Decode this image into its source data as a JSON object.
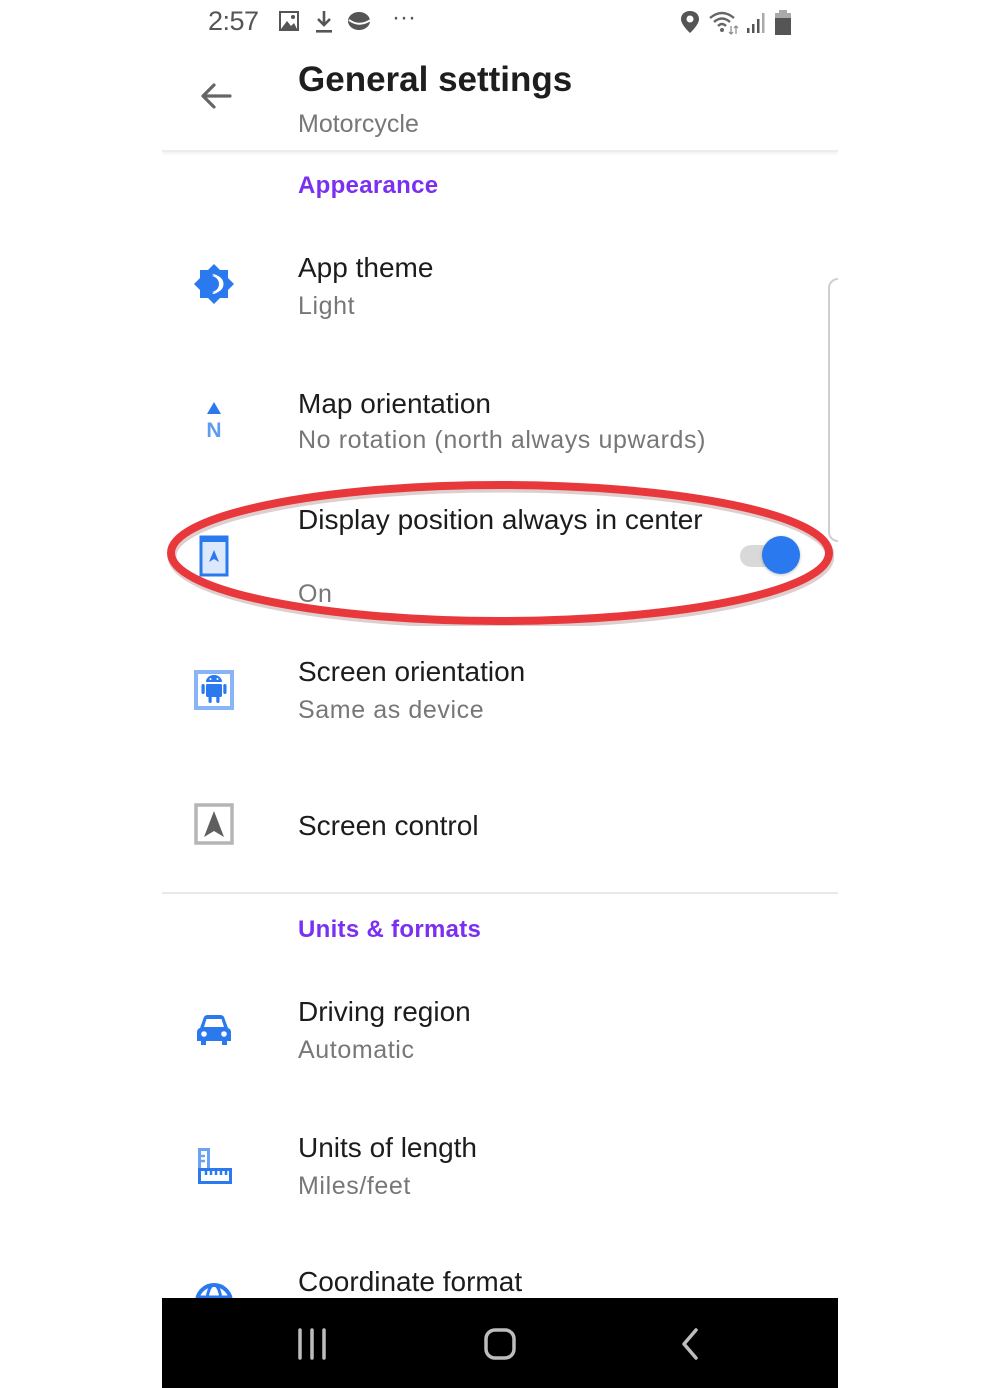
{
  "status_bar": {
    "time": "2:57",
    "left_icons": [
      "image-icon",
      "download-icon",
      "app-notification-icon",
      "more-dots-icon"
    ],
    "right_icons": [
      "location-icon",
      "wifi-icon",
      "signal-icon",
      "battery-icon"
    ],
    "more_label": "···"
  },
  "header": {
    "title": "General settings",
    "subtitle": "Motorcycle",
    "back_icon": "arrow-back-icon"
  },
  "sections": [
    {
      "title": "Appearance",
      "items": [
        {
          "label": "App theme",
          "value": "Light",
          "icon": "theme-brightness-icon"
        },
        {
          "label": "Map orientation",
          "value": "No rotation (north always upwards)",
          "icon": "north-arrow-icon"
        },
        {
          "label": "Display position always in center",
          "value": "On",
          "icon": "position-center-icon",
          "toggle": true,
          "toggle_on": true,
          "highlighted": true
        },
        {
          "label": "Screen orientation",
          "value": "Same as device",
          "icon": "android-screen-icon"
        },
        {
          "label": "Screen control",
          "value": "",
          "icon": "navigation-arrow-icon"
        }
      ]
    },
    {
      "title": "Units & formats",
      "items": [
        {
          "label": "Driving region",
          "value": "Automatic",
          "icon": "car-icon"
        },
        {
          "label": "Units of length",
          "value": "Miles/feet",
          "icon": "ruler-icon"
        },
        {
          "label": "Coordinate format",
          "value": "",
          "icon": "globe-icon"
        }
      ]
    }
  ],
  "nav_bar": {
    "recents": "recents-icon",
    "home": "home-icon",
    "back": "back-chevron-icon"
  },
  "colors": {
    "accent": "#2a79ee",
    "section_header": "#7b2ff0",
    "annotation": "#e8383b"
  }
}
